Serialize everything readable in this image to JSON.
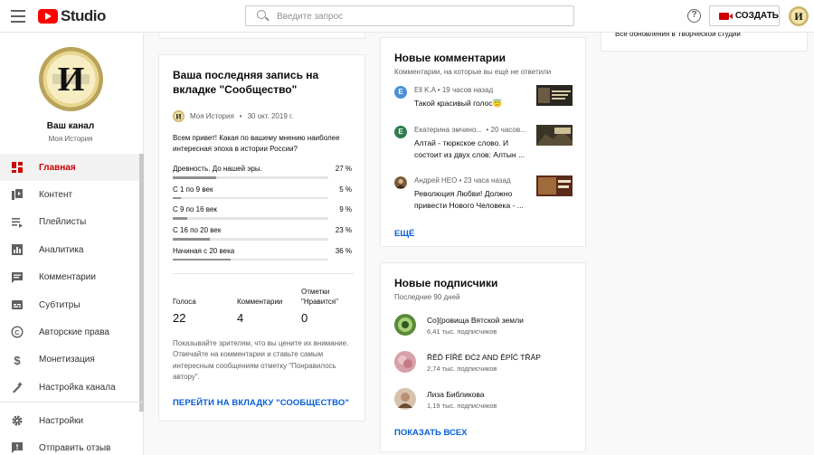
{
  "header": {
    "logo_text": "Studio",
    "search_placeholder": "Введите запрос",
    "create_label": "СОЗДАТЬ"
  },
  "sidebar": {
    "channel_name": "Ваш канал",
    "channel_sub": "Моя История",
    "items": [
      {
        "label": "Главная",
        "icon": "dashboard-icon",
        "active": true
      },
      {
        "label": "Контент",
        "icon": "content-icon"
      },
      {
        "label": "Плейлисты",
        "icon": "playlist-icon"
      },
      {
        "label": "Аналитика",
        "icon": "analytics-icon"
      },
      {
        "label": "Комментарии",
        "icon": "comments-icon"
      },
      {
        "label": "Субтитры",
        "icon": "subtitles-icon"
      },
      {
        "label": "Авторские права",
        "icon": "copyright-icon"
      },
      {
        "label": "Монетизация",
        "icon": "dollar-icon"
      },
      {
        "label": "Настройка канала",
        "icon": "customization-icon"
      }
    ],
    "bottom_items": [
      {
        "label": "Настройки",
        "icon": "gear-icon"
      },
      {
        "label": "Отправить отзыв",
        "icon": "feedback-icon"
      }
    ]
  },
  "community": {
    "title": "Ваша последняя запись на вкладке \"Сообщество\"",
    "author": "Моя История",
    "date": "30 окт. 2019 г.",
    "text": "Всем привет! Какая по вашему мнению наиболее интересная эпоха в истории России?",
    "poll": [
      {
        "label": "Древность. До нашей эры.",
        "pct": "27 %",
        "value": 27
      },
      {
        "label": "С 1 по 9 век",
        "pct": "5 %",
        "value": 5
      },
      {
        "label": "С 9 по 16 век",
        "pct": "9 %",
        "value": 9
      },
      {
        "label": "С 16 по 20 век",
        "pct": "23 %",
        "value": 23
      },
      {
        "label": "Начиная с 20 века",
        "pct": "36 %",
        "value": 36
      }
    ],
    "stats": {
      "votes_label": "Голоса",
      "votes": "22",
      "comments_label": "Комментарии",
      "comments": "4",
      "likes_label": "Отметки \"Нравится\"",
      "likes": "0"
    },
    "hint": "Показывайте зрителям, что вы цените их внимание. Отвечайте на комментарии и ставьте самым интересным сообщениям отметку \"Понравилось автору\".",
    "link": "ПЕРЕЙТИ НА ВКЛАДКУ \"СООБЩЕСТВО\""
  },
  "comments": {
    "title": "Новые комментарии",
    "subtitle": "Комментарии, на которые вы ещё не ответили",
    "items": [
      {
        "initial": "E",
        "color": "#4a90d9",
        "author": "Ell K.A",
        "time": "19 часов назад",
        "text": "Такой красивый голос😇"
      },
      {
        "initial": "E",
        "color": "#2e7d4f",
        "author": "Екатерина эмчино...",
        "time": "20 часов...",
        "text": "Алтай - тюркское слово. И состоит из двух слов: Алтын ..."
      },
      {
        "initial": "",
        "color": "#7a5a3a",
        "author": "Андрей НЕО",
        "time": "23 часа назад",
        "text": "Революция Любви! Должно привести Нового Человека - ..."
      }
    ],
    "more": "ЕЩЁ"
  },
  "subscribers": {
    "title": "Новые подписчики",
    "subtitle": "Последние 90 дней",
    "items": [
      {
        "name": "Со](ровища Вятской земли",
        "count": "6,41 тыс. подписчиков",
        "color": "#5a8a3a"
      },
      {
        "name": "ŘĒĎ FĪŘĒ ĐĆ2 AND ĚPĬĆ TŘĀP",
        "count": "2,74 тыс. подписчиков",
        "color": "#d8a0a8"
      },
      {
        "name": "Лиза Библикова",
        "count": "1,19 тыс. подписчиков",
        "color": "#b89070"
      }
    ],
    "all": "ПОКАЗАТЬ ВСЕХ"
  },
  "news": {
    "text": "Все обновления в Творческой студии"
  }
}
